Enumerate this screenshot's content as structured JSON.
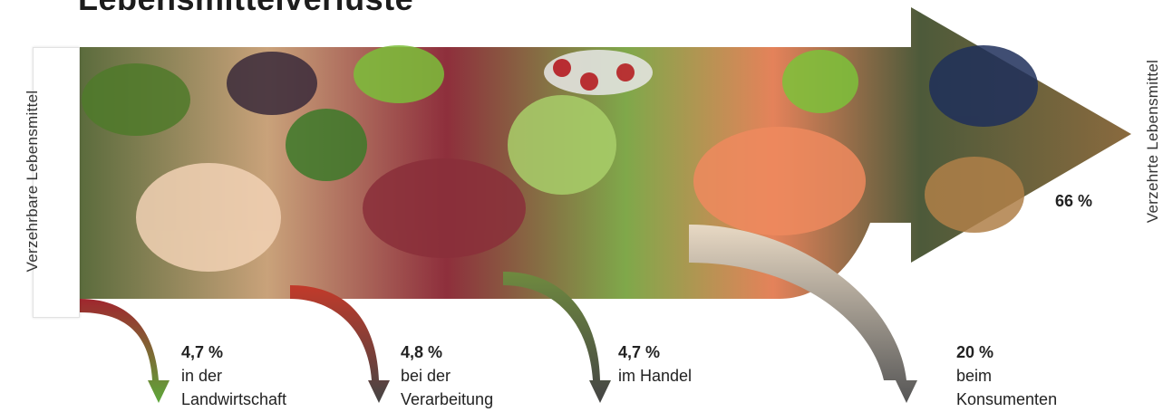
{
  "title": "Lebensmittelverluste",
  "input_label": "Verzehrbare Lebensmittel",
  "output_label": "Verzehrte Lebensmittel",
  "consumed_percent": "66 %",
  "losses": [
    {
      "percent": "4,7 %",
      "line1": "in der",
      "line2": "Landwirtschaft"
    },
    {
      "percent": "4,8 %",
      "line1": "bei der",
      "line2": "Verarbeitung"
    },
    {
      "percent": "4,7 %",
      "line1": "im Handel",
      "line2": ""
    },
    {
      "percent": "20 %",
      "line1": "beim",
      "line2": "Konsumenten"
    }
  ]
}
